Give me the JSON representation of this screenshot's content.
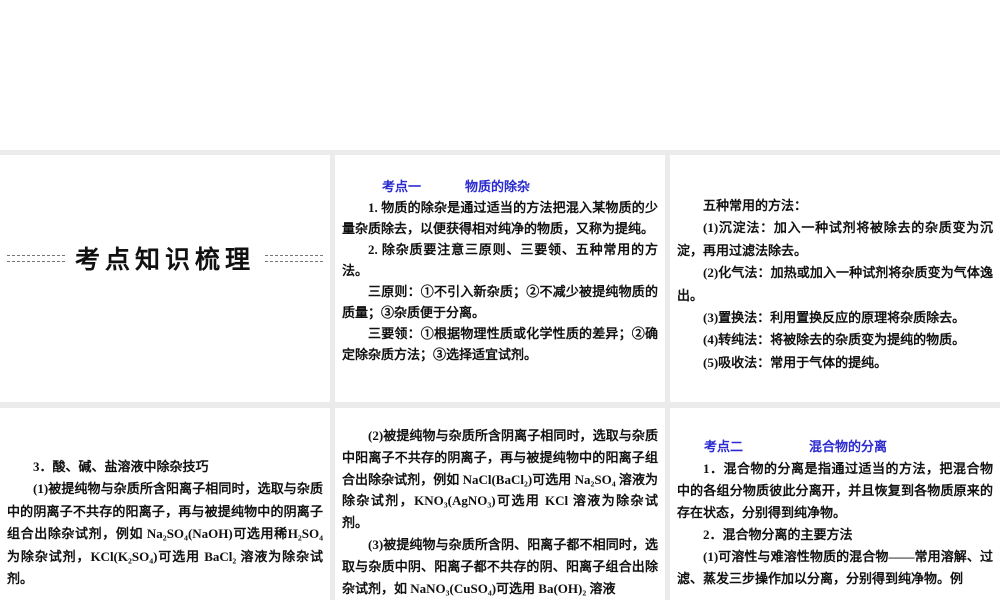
{
  "slides": {
    "s1": {
      "title": "考点知识梳理"
    },
    "s2": {
      "kaodian": "考点一",
      "topic": "物质的除杂",
      "paras": [
        "1. 物质的除杂是通过适当的方法把混入某物质的少量杂质除去，以便获得相对纯净的物质，又称为提纯。",
        "2. 除杂质要注意三原则、三要领、五种常用的方法。",
        "三原则：①不引入新杂质；②不减少被提纯物质的质量；③杂质便于分离。",
        "三要领：①根据物理性质或化学性质的差异；②确定除杂质方法；③选择适宜试剂。"
      ]
    },
    "s3": {
      "paras": [
        "五种常用的方法：",
        "(1)沉淀法：加入一种试剂将被除去的杂质变为沉淀，再用过滤法除去。",
        "(2)化气法：加热或加入一种试剂将杂质变为气体逸出。",
        "(3)置换法：利用置换反应的原理将杂质除去。",
        "(4)转纯法：将被除去的杂质变为提纯的物质。",
        "(5)吸收法：常用于气体的提纯。"
      ]
    },
    "s4": {
      "paras": [
        "3．酸、碱、盐溶液中除杂技巧",
        "(1)被提纯物与杂质所含阳离子相同时，选取与杂质中的阴离子不共存的阳离子，再与被提纯物中的阴离子组合出除杂试剂，例如 Na₂SO₄(NaOH)可选用稀H₂SO₄ 为除杂试剂，KCl(K₂SO₄)可选用 BaCl₂ 溶液为除杂试剂。"
      ]
    },
    "s5": {
      "paras": [
        "(2)被提纯物与杂质所含阴离子相同时，选取与杂质中阳离子不共存的阴离子，再与被提纯物中的阳离子组合出除杂试剂，例如 NaCl(BaCl₂)可选用 Na₂SO₄ 溶液为除杂试剂，KNO₃(AgNO₃)可选用 KCl 溶液为除杂试剂。",
        "(3)被提纯物与杂质所含阴、阳离子都不相同时，选取与杂质中阴、阳离子都不共存的阴、阳离子组合出除杂试剂，如 NaNO₃(CuSO₄)可选用 Ba(OH)₂ 溶液"
      ]
    },
    "s6": {
      "kaodian": "考点二",
      "topic": "混合物的分离",
      "paras": [
        "1．混合物的分离是指通过适当的方法，把混合物中的各组分物质彼此分离开，并且恢复到各物质原来的存在状态，分别得到纯净物。",
        "2．混合物分离的主要方法",
        "(1)可溶性与难溶性物质的混合物——常用溶解、过滤、蒸发三步操作加以分离，分别得到纯净物。例"
      ]
    }
  }
}
